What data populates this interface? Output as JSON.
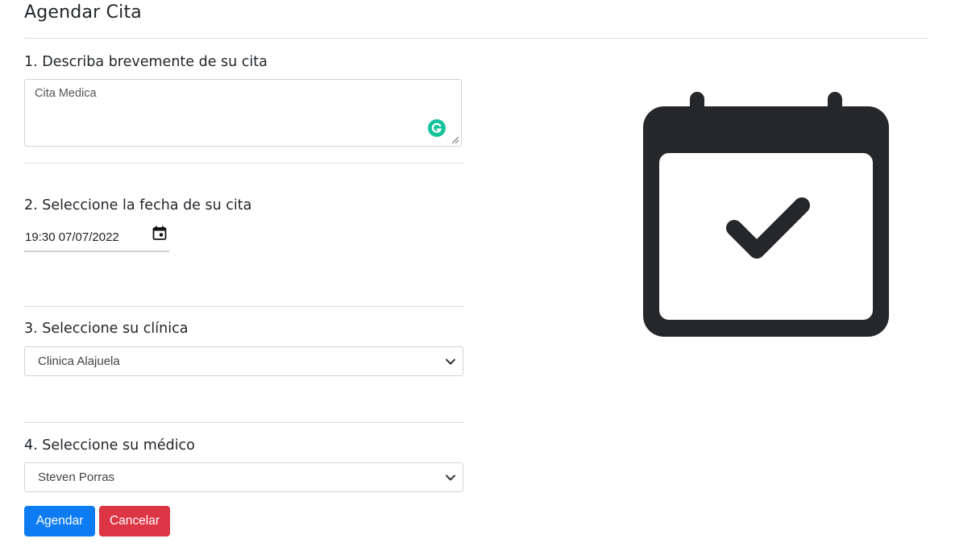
{
  "page": {
    "title": "Agendar Cita"
  },
  "form": {
    "step1": {
      "label": "1. Describa brevemente de su cita",
      "value": "Cita Medica"
    },
    "step2": {
      "label": "2. Seleccione la fecha de su cita",
      "value": "19:30 07/07/2022"
    },
    "step3": {
      "label": "3. Seleccione su clínica",
      "selected": "Clinica Alajuela"
    },
    "step4": {
      "label": "4. Seleccione su médico",
      "selected": "Steven Porras"
    }
  },
  "actions": {
    "submit_label": "Agendar",
    "cancel_label": "Cancelar"
  },
  "colors": {
    "primary": "#0d7cf2",
    "danger": "#dc3545",
    "icon_dark": "#25272b",
    "grammarly": "#15c39a"
  },
  "icons": {
    "illustration": "calendar-check-icon",
    "datepicker": "calendar-picker-icon",
    "select_arrow": "chevron-down-icon",
    "writing_assistant": "grammarly-icon"
  }
}
